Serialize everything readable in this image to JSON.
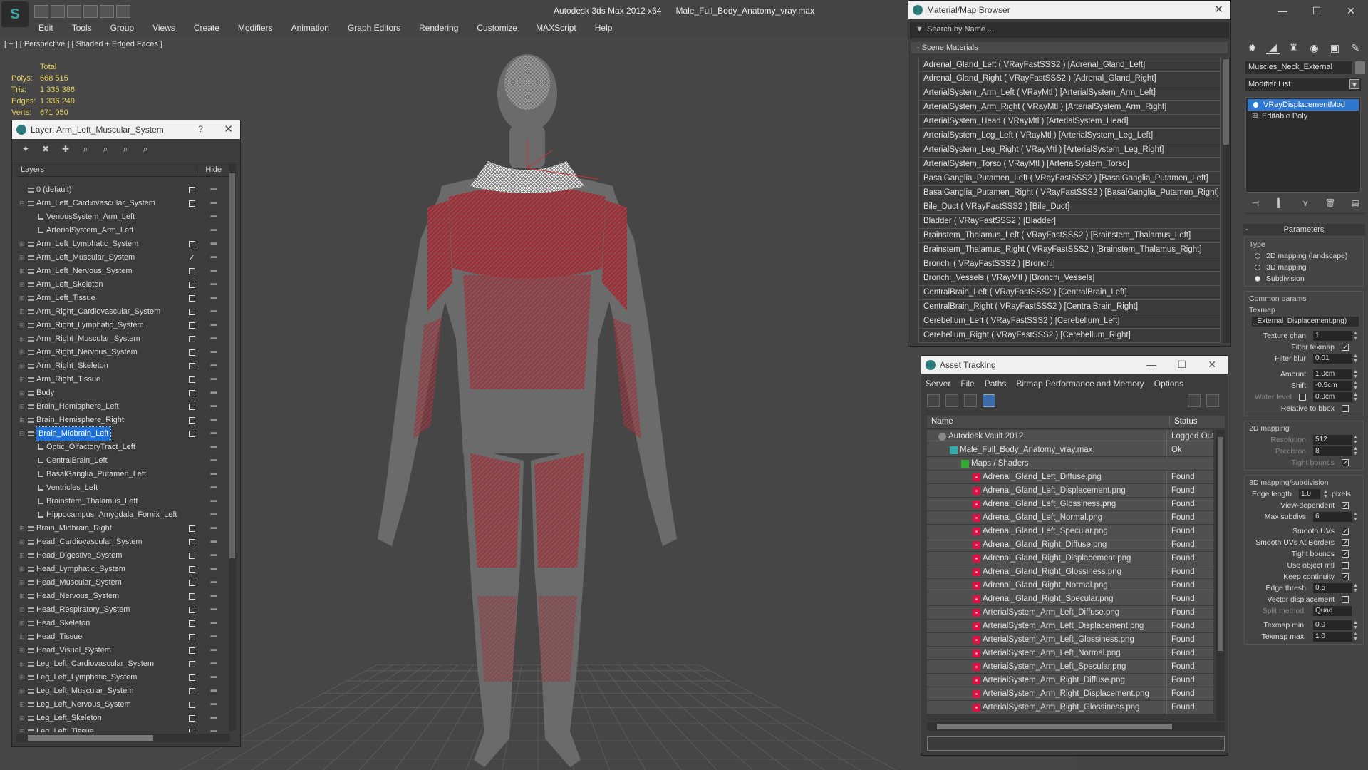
{
  "app": {
    "title": "Autodesk 3ds Max  2012 x64",
    "file": "Male_Full_Body_Anatomy_vray.max",
    "logo_letter": "S",
    "menu": [
      "Edit",
      "Tools",
      "Group",
      "Views",
      "Create",
      "Modifiers",
      "Animation",
      "Graph Editors",
      "Rendering",
      "Customize",
      "MAXScript",
      "Help"
    ]
  },
  "viewport": {
    "label": "[ + ] [ Perspective ] [ Shaded + Edged Faces ]",
    "stats": {
      "header": "Total",
      "rows": [
        {
          "k": "Polys:",
          "v": "668 515"
        },
        {
          "k": "Tris:",
          "v": "1 335 386"
        },
        {
          "k": "Edges:",
          "v": "1 336 249"
        },
        {
          "k": "Verts:",
          "v": "671 050"
        }
      ]
    },
    "colors": {
      "muscle": "#b8323a",
      "skin": "#6a6a6a",
      "wire": "#ffffff",
      "stats": "#e6d35a"
    }
  },
  "layer_window": {
    "title": "Layer: Arm_Left_Muscular_System",
    "help": "?",
    "col_layers": "Layers",
    "col_hide": "Hide",
    "rows": [
      {
        "name": "0 (default)",
        "level": 0,
        "box": true
      },
      {
        "name": "Arm_Left_Cardiovascular_System",
        "level": 0,
        "box": true,
        "exp": "−"
      },
      {
        "name": "VenousSystem_Arm_Left",
        "level": 1
      },
      {
        "name": "ArterialSystem_Arm_Left",
        "level": 1
      },
      {
        "name": "Arm_Left_Lymphatic_System",
        "level": 0,
        "box": true,
        "exp": "+"
      },
      {
        "name": "Arm_Left_Muscular_System",
        "level": 0,
        "check": true,
        "exp": "+"
      },
      {
        "name": "Arm_Left_Nervous_System",
        "level": 0,
        "box": true,
        "exp": "+"
      },
      {
        "name": "Arm_Left_Skeleton",
        "level": 0,
        "box": true,
        "exp": "+"
      },
      {
        "name": "Arm_Left_Tissue",
        "level": 0,
        "box": true,
        "exp": "+"
      },
      {
        "name": "Arm_Right_Cardiovascular_System",
        "level": 0,
        "box": true,
        "exp": "+"
      },
      {
        "name": "Arm_Right_Lymphatic_System",
        "level": 0,
        "box": true,
        "exp": "+"
      },
      {
        "name": "Arm_Right_Muscular_System",
        "level": 0,
        "box": true,
        "exp": "+"
      },
      {
        "name": "Arm_Right_Nervous_System",
        "level": 0,
        "box": true,
        "exp": "+"
      },
      {
        "name": "Arm_Right_Skeleton",
        "level": 0,
        "box": true,
        "exp": "+"
      },
      {
        "name": "Arm_Right_Tissue",
        "level": 0,
        "box": true,
        "exp": "+"
      },
      {
        "name": "Body",
        "level": 0,
        "box": true,
        "exp": "+"
      },
      {
        "name": "Brain_Hemisphere_Left",
        "level": 0,
        "box": true,
        "exp": "+"
      },
      {
        "name": "Brain_Hemisphere_Right",
        "level": 0,
        "box": true,
        "exp": "+"
      },
      {
        "name": "Brain_Midbrain_Left",
        "level": 0,
        "box": true,
        "exp": "−",
        "selected": true
      },
      {
        "name": "Optic_OlfactoryTract_Left",
        "level": 1
      },
      {
        "name": "CentralBrain_Left",
        "level": 1
      },
      {
        "name": "BasalGanglia_Putamen_Left",
        "level": 1
      },
      {
        "name": "Ventricles_Left",
        "level": 1
      },
      {
        "name": "Brainstem_Thalamus_Left",
        "level": 1
      },
      {
        "name": "Hippocampus_Amygdala_Fornix_Left",
        "level": 1
      },
      {
        "name": "Brain_Midbrain_Right",
        "level": 0,
        "box": true,
        "exp": "+"
      },
      {
        "name": "Head_Cardiovascular_System",
        "level": 0,
        "box": true,
        "exp": "+"
      },
      {
        "name": "Head_Digestive_System",
        "level": 0,
        "box": true,
        "exp": "+"
      },
      {
        "name": "Head_Lymphatic_System",
        "level": 0,
        "box": true,
        "exp": "+"
      },
      {
        "name": "Head_Muscular_System",
        "level": 0,
        "box": true,
        "exp": "+"
      },
      {
        "name": "Head_Nervous_System",
        "level": 0,
        "box": true,
        "exp": "+"
      },
      {
        "name": "Head_Respiratory_System",
        "level": 0,
        "box": true,
        "exp": "+"
      },
      {
        "name": "Head_Skeleton",
        "level": 0,
        "box": true,
        "exp": "+"
      },
      {
        "name": "Head_Tissue",
        "level": 0,
        "box": true,
        "exp": "+"
      },
      {
        "name": "Head_Visual_System",
        "level": 0,
        "box": true,
        "exp": "+"
      },
      {
        "name": "Leg_Left_Cardiovascular_System",
        "level": 0,
        "box": true,
        "exp": "+"
      },
      {
        "name": "Leg_Left_Lymphatic_System",
        "level": 0,
        "box": true,
        "exp": "+"
      },
      {
        "name": "Leg_Left_Muscular_System",
        "level": 0,
        "box": true,
        "exp": "+"
      },
      {
        "name": "Leg_Left_Nervous_System",
        "level": 0,
        "box": true,
        "exp": "+"
      },
      {
        "name": "Leg_Left_Skeleton",
        "level": 0,
        "box": true,
        "exp": "+"
      },
      {
        "name": "Leg_Left_Tissue",
        "level": 0,
        "box": true,
        "exp": "+"
      }
    ]
  },
  "material_browser": {
    "title": "Material/Map Browser",
    "search_placeholder": "Search by Name ...",
    "section": "Scene Materials",
    "items": [
      "Adrenal_Gland_Left  ( VRayFastSSS2 )  [Adrenal_Gland_Left]",
      "Adrenal_Gland_Right  ( VRayFastSSS2 )  [Adrenal_Gland_Right]",
      "ArterialSystem_Arm_Left  ( VRayMtl )  [ArterialSystem_Arm_Left]",
      "ArterialSystem_Arm_Right  ( VRayMtl )  [ArterialSystem_Arm_Right]",
      "ArterialSystem_Head  ( VRayMtl )  [ArterialSystem_Head]",
      "ArterialSystem_Leg_Left  ( VRayMtl )  [ArterialSystem_Leg_Left]",
      "ArterialSystem_Leg_Right  ( VRayMtl )  [ArterialSystem_Leg_Right]",
      "ArterialSystem_Torso  ( VRayMtl )  [ArterialSystem_Torso]",
      "BasalGanglia_Putamen_Left  ( VRayFastSSS2 )  [BasalGanglia_Putamen_Left]",
      "BasalGanglia_Putamen_Right  ( VRayFastSSS2 )  [BasalGanglia_Putamen_Right]",
      "Bile_Duct  ( VRayFastSSS2 )  [Bile_Duct]",
      "Bladder  ( VRayFastSSS2 )  [Bladder]",
      "Brainstem_Thalamus_Left  ( VRayFastSSS2 )  [Brainstem_Thalamus_Left]",
      "Brainstem_Thalamus_Right  ( VRayFastSSS2 )  [Brainstem_Thalamus_Right]",
      "Bronchi  ( VRayFastSSS2 )  [Bronchi]",
      "Bronchi_Vessels  ( VRayMtl )  [Bronchi_Vessels]",
      "CentralBrain_Left  ( VRayFastSSS2 )  [CentralBrain_Left]",
      "CentralBrain_Right  ( VRayFastSSS2 )  [CentralBrain_Right]",
      "Cerebellum_Left  ( VRayFastSSS2 )  [Cerebellum_Left]",
      "Cerebellum_Right  ( VRayFastSSS2 )  [Cerebellum_Right]"
    ]
  },
  "asset_tracking": {
    "title": "Asset Tracking",
    "menu": [
      "Server",
      "File",
      "Paths",
      "Bitmap Performance and Memory",
      "Options"
    ],
    "col_name": "Name",
    "col_status": "Status",
    "rows": [
      {
        "name": "Autodesk Vault 2012",
        "status": "Logged Out",
        "icon": "vault",
        "level": 1
      },
      {
        "name": "Male_Full_Body_Anatomy_vray.max",
        "status": "Ok",
        "icon": "file",
        "level": 2
      },
      {
        "name": "Maps / Shaders",
        "status": "",
        "icon": "maps",
        "level": 3
      },
      {
        "name": "Adrenal_Gland_Left_Diffuse.png",
        "status": "Found",
        "icon": "png",
        "level": 4
      },
      {
        "name": "Adrenal_Gland_Left_Displacement.png",
        "status": "Found",
        "icon": "png",
        "level": 4
      },
      {
        "name": "Adrenal_Gland_Left_Glossiness.png",
        "status": "Found",
        "icon": "png",
        "level": 4
      },
      {
        "name": "Adrenal_Gland_Left_Normal.png",
        "status": "Found",
        "icon": "png",
        "level": 4
      },
      {
        "name": "Adrenal_Gland_Left_Specular.png",
        "status": "Found",
        "icon": "png",
        "level": 4
      },
      {
        "name": "Adrenal_Gland_Right_Diffuse.png",
        "status": "Found",
        "icon": "png",
        "level": 4
      },
      {
        "name": "Adrenal_Gland_Right_Displacement.png",
        "status": "Found",
        "icon": "png",
        "level": 4
      },
      {
        "name": "Adrenal_Gland_Right_Glossiness.png",
        "status": "Found",
        "icon": "png",
        "level": 4
      },
      {
        "name": "Adrenal_Gland_Right_Normal.png",
        "status": "Found",
        "icon": "png",
        "level": 4
      },
      {
        "name": "Adrenal_Gland_Right_Specular.png",
        "status": "Found",
        "icon": "png",
        "level": 4
      },
      {
        "name": "ArterialSystem_Arm_Left_Diffuse.png",
        "status": "Found",
        "icon": "png",
        "level": 4
      },
      {
        "name": "ArterialSystem_Arm_Left_Displacement.png",
        "status": "Found",
        "icon": "png",
        "level": 4
      },
      {
        "name": "ArterialSystem_Arm_Left_Glossiness.png",
        "status": "Found",
        "icon": "png",
        "level": 4
      },
      {
        "name": "ArterialSystem_Arm_Left_Normal.png",
        "status": "Found",
        "icon": "png",
        "level": 4
      },
      {
        "name": "ArterialSystem_Arm_Left_Specular.png",
        "status": "Found",
        "icon": "png",
        "level": 4
      },
      {
        "name": "ArterialSystem_Arm_Right_Diffuse.png",
        "status": "Found",
        "icon": "png",
        "level": 4
      },
      {
        "name": "ArterialSystem_Arm_Right_Displacement.png",
        "status": "Found",
        "icon": "png",
        "level": 4
      },
      {
        "name": "ArterialSystem_Arm_Right_Glossiness.png",
        "status": "Found",
        "icon": "png",
        "level": 4
      }
    ]
  },
  "command_panel": {
    "object_name": "Muscles_Neck_External",
    "modifier_list": "Modifier List",
    "stack": [
      "VRayDisplacementMod",
      "Editable Poly"
    ],
    "params_title": "Parameters",
    "type_label": "Type",
    "type_options": [
      {
        "label": "2D mapping (landscape)",
        "on": false
      },
      {
        "label": "3D mapping",
        "on": false
      },
      {
        "label": "Subdivision",
        "on": true
      }
    ],
    "common_label": "Common params",
    "texmap_label": "Texmap",
    "texmap_value": "_External_Displacement.png)",
    "texture_chan_label": "Texture chan",
    "texture_chan": "1",
    "filter_texmap_label": "Filter texmap",
    "filter_blur_label": "Filter blur",
    "filter_blur": "0.01",
    "amount_label": "Amount",
    "amount": "1.0cm",
    "shift_label": "Shift",
    "shift": "-0.5cm",
    "water_label": "Water level",
    "water": "0.0cm",
    "relbbox_label": "Relative to bbox",
    "map2d_label": "2D mapping",
    "resolution_label": "Resolution",
    "resolution": "512",
    "precision_label": "Precision",
    "precision": "8",
    "tight2d_label": "Tight bounds",
    "map3d_label": "3D mapping/subdivision",
    "edge_label": "Edge length",
    "edge": "1.0",
    "pixels_label": "pixels",
    "viewdep_label": "View-dependent",
    "maxsub_label": "Max subdivs",
    "maxsub": "6",
    "smoothuv_label": "Smooth UVs",
    "smoothuvb_label": "Smooth UVs At Borders",
    "tight_label": "Tight bounds",
    "useobj_label": "Use object mtl",
    "keepcont_label": "Keep continuity",
    "edgethresh_label": "Edge thresh",
    "edgethresh": "0.5",
    "vecdisp_label": "Vector displacement",
    "split_label": "Split method:",
    "split": "Quad",
    "texmin_label": "Texmap min:",
    "texmin": "0.0",
    "texmax_label": "Texmap max:",
    "texmax": "1.0"
  }
}
